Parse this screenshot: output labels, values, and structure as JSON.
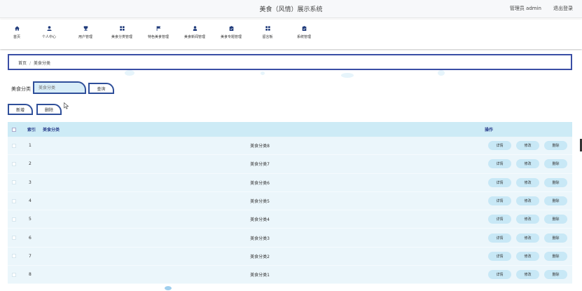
{
  "header": {
    "title": "美食（风情）展示系统",
    "user": "管理员 admin",
    "logout": "退出登录"
  },
  "nav": [
    {
      "label": "首页",
      "icon": "home-icon"
    },
    {
      "label": "个人中心",
      "icon": "user-icon"
    },
    {
      "label": "用户管理",
      "icon": "trophy-icon"
    },
    {
      "label": "美食分类管理",
      "icon": "grid-icon"
    },
    {
      "label": "特色美食管理",
      "icon": "flag-icon"
    },
    {
      "label": "美食新闻管理",
      "icon": "person-icon"
    },
    {
      "label": "美食专题管理",
      "icon": "clipboard-icon"
    },
    {
      "label": "留言板",
      "icon": "grid-icon"
    },
    {
      "label": "系统管理",
      "icon": "clipboard-icon"
    }
  ],
  "breadcrumb": {
    "home": "首页",
    "separator": "/",
    "current": "美食分类"
  },
  "search": {
    "label": "美食分类",
    "placeholder": "美食分类",
    "button": "查询"
  },
  "actions": {
    "add": "新增",
    "delete": "删除"
  },
  "table": {
    "headers": {
      "index": "索引",
      "name": "美食分类",
      "ops": "操作"
    },
    "ops": {
      "detail": "详情",
      "edit": "修改",
      "delete": "删除"
    },
    "rows": [
      {
        "index": "1",
        "name": "美食分类8"
      },
      {
        "index": "2",
        "name": "美食分类7"
      },
      {
        "index": "3",
        "name": "美食分类6"
      },
      {
        "index": "4",
        "name": "美食分类5"
      },
      {
        "index": "5",
        "name": "美食分类4"
      },
      {
        "index": "6",
        "name": "美食分类3"
      },
      {
        "index": "7",
        "name": "美食分类2"
      },
      {
        "index": "8",
        "name": "美食分类1"
      }
    ]
  },
  "colors": {
    "accent": "#2f4f9a",
    "nav_icon": "#1f3a7a",
    "header_bg": "#cdebf6",
    "row_bg": "#ebf6fb",
    "op_bg": "#c8e8f6"
  }
}
